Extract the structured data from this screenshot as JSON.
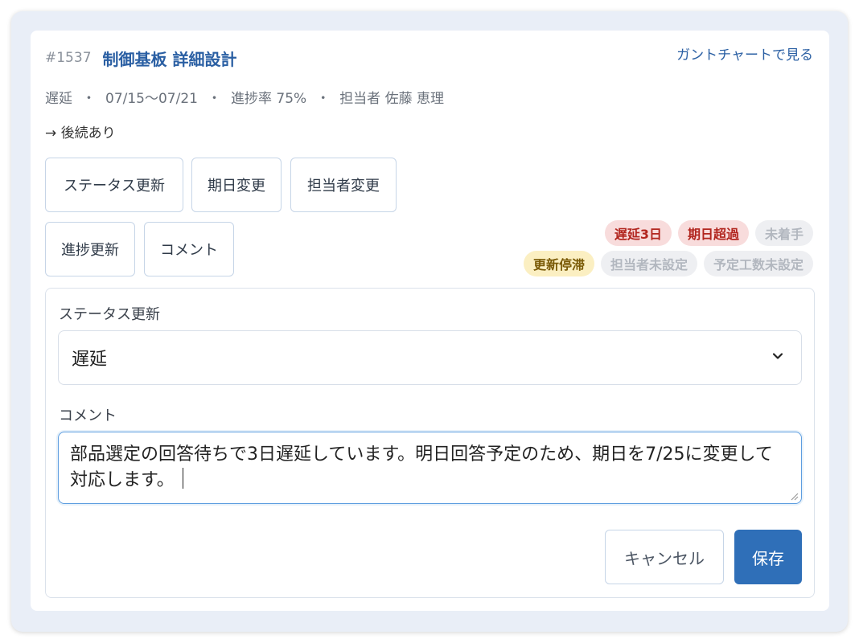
{
  "task": {
    "id": "#1537",
    "title": "制御基板 詳細設計",
    "gantt_link": "ガントチャートで見る"
  },
  "meta": {
    "status": "遅延",
    "period": "07/15〜07/21",
    "progress": "進捗率 75%",
    "assignee": "担当者 佐藤 恵理",
    "separator": "・"
  },
  "successor": "→ 後続あり",
  "actions": {
    "status_update": "ステータス更新",
    "due_change": "期日変更",
    "assignee_change": "担当者変更",
    "progress_update": "進捗更新",
    "comment": "コメント"
  },
  "tags": {
    "row1": [
      "遅延3日",
      "期日超過",
      "未着手"
    ],
    "row2": [
      "更新停滞",
      "担当者未設定",
      "予定工数未設定"
    ]
  },
  "form": {
    "status_label": "ステータス更新",
    "status_value": "遅延",
    "comment_label": "コメント",
    "comment_value": "部品選定の回答待ちで3日遅延しています。明日回答予定のため、期日を7/25に変更して対応します。",
    "cancel": "キャンセル",
    "save": "保存"
  },
  "colors": {
    "accent": "#2a5fa3",
    "save_button": "#2f6fb8",
    "tag_red_bg": "#f8dcdc",
    "tag_red_text": "#b2261f",
    "tag_yellow_bg": "#fbefc2",
    "tag_gray_bg": "#eeeff2"
  },
  "icons": {
    "dropdown": "chevron-down-icon",
    "textarea_resize": "resize-handle-icon"
  }
}
